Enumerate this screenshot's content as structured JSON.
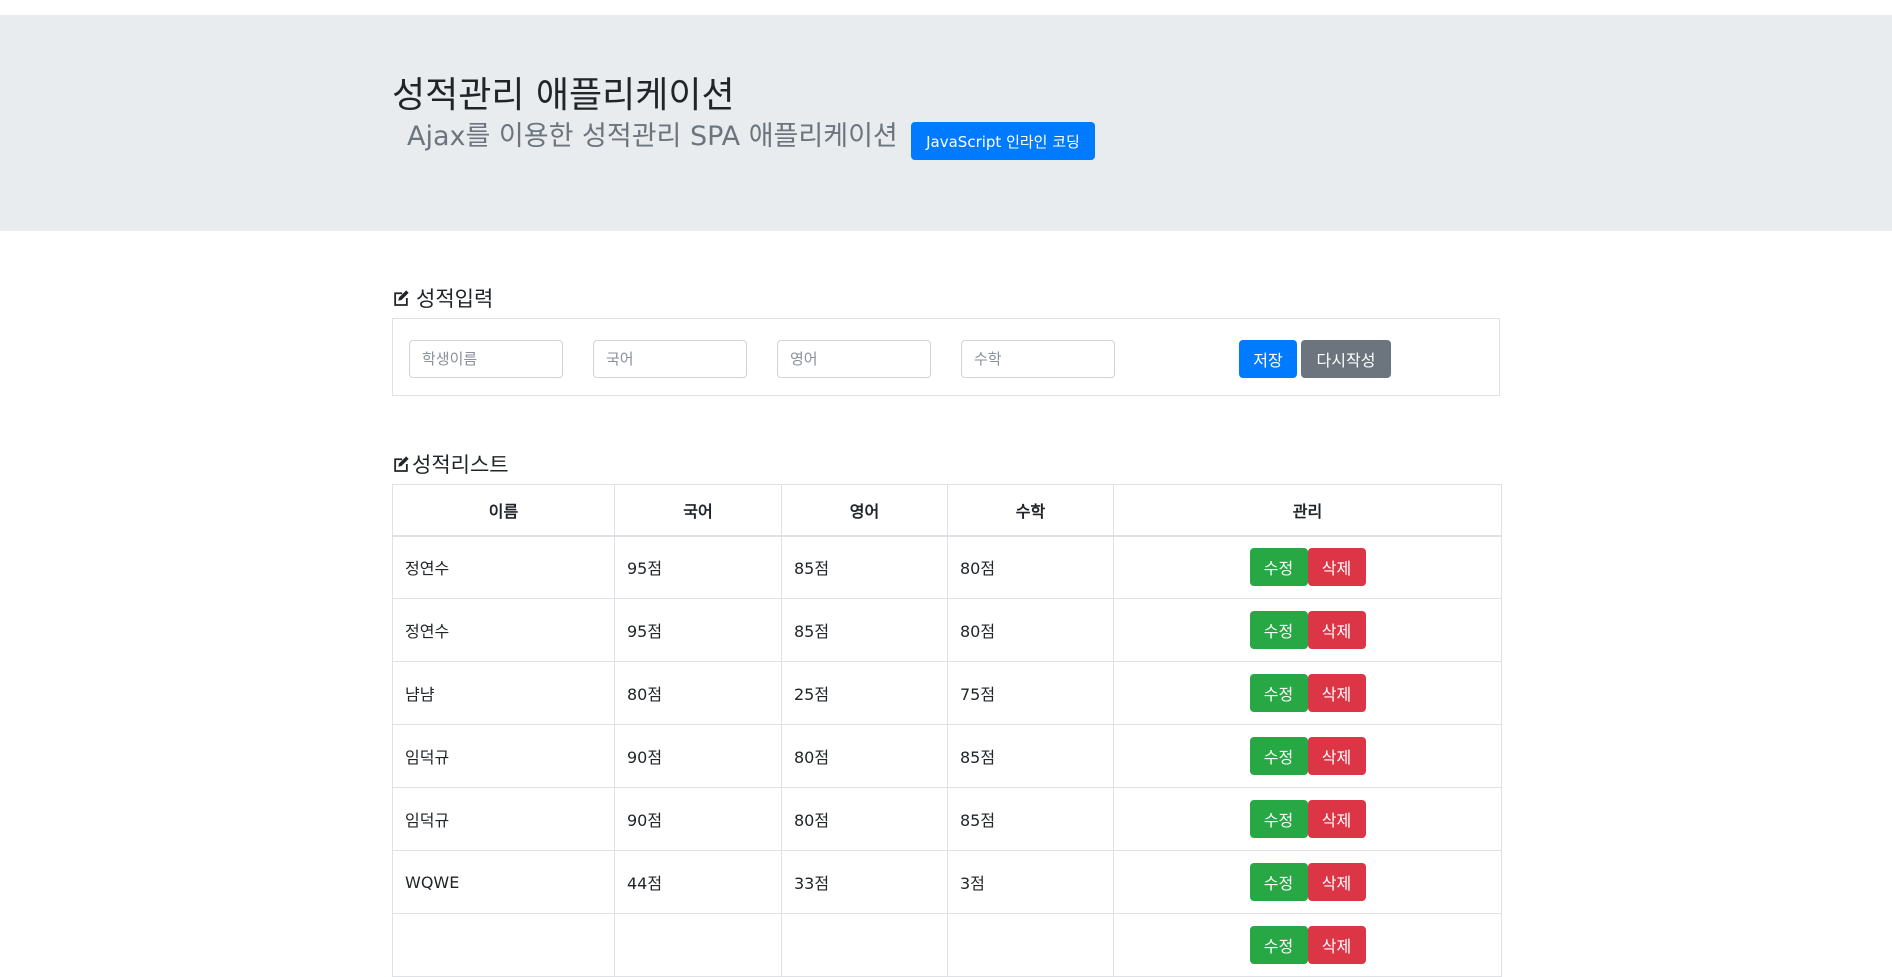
{
  "header": {
    "title": "성적관리 애플리케이션",
    "subtitle": "Ajax를 이용한 성적관리 SPA 애플리케이션",
    "inline_coding_button": "JavaScript 인라인 코딩"
  },
  "input_section": {
    "title": "성적입력",
    "name_placeholder": "학생이름",
    "korean_placeholder": "국어",
    "english_placeholder": "영어",
    "math_placeholder": "수학",
    "save_label": "저장",
    "reset_label": "다시작성"
  },
  "list_section": {
    "title": "성적리스트",
    "columns": [
      "이름",
      "국어",
      "영어",
      "수학",
      "관리"
    ],
    "edit_label": "수정",
    "delete_label": "삭제",
    "rows": [
      {
        "name": "정연수",
        "korean": "95점",
        "english": "85점",
        "math": "80점"
      },
      {
        "name": "정연수",
        "korean": "95점",
        "english": "85점",
        "math": "80점"
      },
      {
        "name": "냠냠",
        "korean": "80점",
        "english": "25점",
        "math": "75점"
      },
      {
        "name": "임덕규",
        "korean": "90점",
        "english": "80점",
        "math": "85점"
      },
      {
        "name": "임덕규",
        "korean": "90점",
        "english": "80점",
        "math": "85점"
      },
      {
        "name": "WQWE",
        "korean": "44점",
        "english": "33점",
        "math": "3점"
      },
      {
        "name": "",
        "korean": "",
        "english": "",
        "math": ""
      }
    ]
  },
  "colors": {
    "primary": "#007bff",
    "secondary": "#6c757d",
    "success": "#28a745",
    "danger": "#dc3545",
    "jumbotron": "#e9ecef"
  }
}
